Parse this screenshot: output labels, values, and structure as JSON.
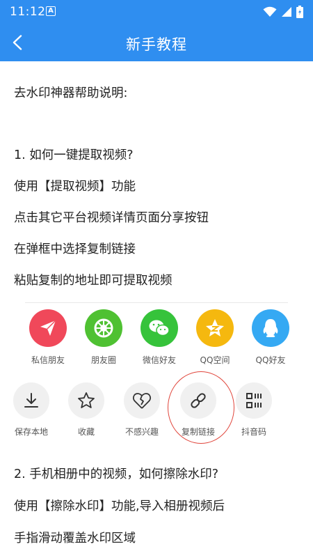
{
  "status_bar": {
    "time": "11:12",
    "a_badge": "A"
  },
  "app_bar": {
    "title": "新手教程"
  },
  "content": {
    "intro": "去水印神器帮助说明:",
    "q1": "1. 如何一键提取视频?",
    "q1_step1": "使用【提取视频】功能",
    "q1_step2": "点击其它平台视频详情页面分享按钮",
    "q1_step3": "在弹框中选择复制链接",
    "q1_step4": "粘贴复制的地址即可提取视频",
    "q2": "2. 手机相册中的视频，如何擦除水印?",
    "q2_step1": "使用【擦除水印】功能,导入相册视频后",
    "q2_step2": "手指滑动覆盖水印区域"
  },
  "share_row": [
    {
      "label": "私信朋友",
      "icon": "paper-plane-icon",
      "color": "#f0485a"
    },
    {
      "label": "朋友圈",
      "icon": "moments-aperture-icon",
      "color": "#4fc132"
    },
    {
      "label": "微信好友",
      "icon": "wechat-icon",
      "color": "#36c33b"
    },
    {
      "label": "QQ空间",
      "icon": "qzone-star-icon",
      "color": "#f5b80f"
    },
    {
      "label": "QQ好友",
      "icon": "qq-penguin-icon",
      "color": "#35a9f3"
    }
  ],
  "action_row": [
    {
      "label": "保存本地",
      "icon": "download-icon"
    },
    {
      "label": "收藏",
      "icon": "star-icon"
    },
    {
      "label": "不感兴趣",
      "icon": "broken-heart-icon"
    },
    {
      "label": "复制链接",
      "icon": "link-icon"
    },
    {
      "label": "抖音码",
      "icon": "qr-code-icon"
    }
  ],
  "colors": {
    "primary": "#2f8ef0",
    "highlight_ring": "#e0443a"
  }
}
